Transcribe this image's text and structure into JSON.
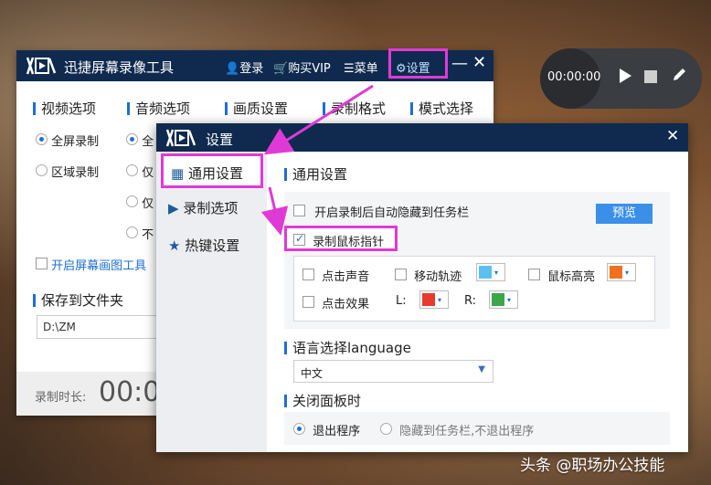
{
  "main_window": {
    "title": "迅捷屏幕录像工具",
    "login": "登录",
    "vip": "购买VIP",
    "menu": "菜单",
    "settings": "设置",
    "tabs": [
      "视频选项",
      "音频选项",
      "画质设置",
      "录制格式",
      "模式选择"
    ],
    "video_full": "全屏录制",
    "video_area": "区域录制",
    "audio_full": "全",
    "audio_only1": "仅",
    "audio_only2": "仅",
    "audio_none": "不",
    "draw_tool": "开启屏幕画图工具",
    "save_label": "保存到文件夹",
    "save_path": "D:\\ZM",
    "duration_label": "录制时长:",
    "duration_value": "00:0"
  },
  "float_bar": {
    "time": "00:00:00"
  },
  "settings_dialog": {
    "title": "设置",
    "nav": [
      "通用设置",
      "录制选项",
      "热键设置"
    ],
    "general_heading": "通用设置",
    "auto_hide": "开启录制后自动隐藏到任务栏",
    "preview": "预览",
    "record_cursor": "录制鼠标指针",
    "click_sound": "点击声音",
    "move_track": "移动轨迹",
    "cursor_highlight": "鼠标高亮",
    "click_effect": "点击效果",
    "left_label": "L:",
    "right_label": "R:",
    "language_heading": "语言选择language",
    "language_value": "中文",
    "close_heading": "关闭面板时",
    "exit_program": "退出程序",
    "hide_taskbar": "隐藏到任务栏,不退出程序"
  },
  "watermark": "头条 @职场办公技能",
  "colors": {
    "track": "#5bc0f0",
    "highlight": "#f07020",
    "left": "#e83a2e",
    "right": "#3aa84a",
    "accent": "#1e6fcf",
    "titlebar": "#0f2a4e",
    "annotation": "#e03ad6"
  }
}
